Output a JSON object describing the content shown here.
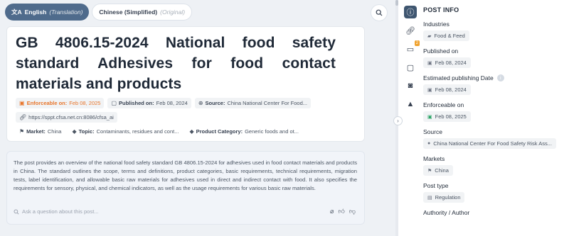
{
  "language_toggle": {
    "active_label": "English",
    "active_note": "(Translation)",
    "inactive_label": "Chinese (Simplified)",
    "inactive_note": "(Original)"
  },
  "post": {
    "title": "GB 4806.15-2024 National food safety standard Adhesives for food contact materials and products",
    "enforceable_label": "Enforceable on:",
    "enforceable_value": "Feb 08, 2025",
    "published_label": "Published on:",
    "published_value": "Feb 08, 2024",
    "source_label": "Source:",
    "source_value": "China National Center For Food...",
    "url": "https://sppt.cfsa.net.cn:8086/cfsa_ai",
    "market_label": "Market:",
    "market_value": "China",
    "topic_label": "Topic:",
    "topic_value": "Contaminants, residues and cont...",
    "category_label": "Product Category:",
    "category_value": "Generic foods and ot..."
  },
  "summary": {
    "text": "The post provides an overview of the national food safety standard GB 4806.15-2024 for adhesives used in food contact materials and products in China. The standard outlines the scope, terms and definitions, product categories, basic requirements, technical requirements, migration tests, label identification, and allowable basic raw materials for adhesives used in direct and indirect contact with food. It also specifies the requirements for sensory, physical, and chemical indicators, as well as the usage requirements for various basic raw materials.",
    "ask_placeholder": "Ask a question about this post..."
  },
  "rail": {
    "badge_count": "2"
  },
  "post_info": {
    "title": "POST INFO",
    "industries_label": "Industries",
    "industries_value": "Food & Feed",
    "published_label": "Published on",
    "published_value": "Feb 08, 2024",
    "estimated_label": "Estimated publishing Date",
    "estimated_value": "Feb 08, 2024",
    "enforceable_label": "Enforceable on",
    "enforceable_value": "Feb 08, 2025",
    "source_label": "Source",
    "source_value": "China National Center For Food Safety Risk Ass...",
    "markets_label": "Markets",
    "markets_value": "China",
    "post_type_label": "Post type",
    "post_type_value": "Regulation",
    "authority_label": "Authority / Author"
  },
  "colors": {
    "toggle_active": "#4f6b8c",
    "enforceable_orange": "#e8752b",
    "rail_active": "#3f5670",
    "badge": "#f0a22e"
  },
  "icons": [
    "translate-icon",
    "search-icon",
    "calendar-icon",
    "globe-icon",
    "link-icon",
    "flag-icon",
    "tag-icon",
    "info-icon",
    "attach-icon",
    "thumbs-up-icon",
    "thumbs-down-icon",
    "chevron-right-icon",
    "folder-icon",
    "warning-icon",
    "robot-icon",
    "chat-icon",
    "comment-icon"
  ]
}
